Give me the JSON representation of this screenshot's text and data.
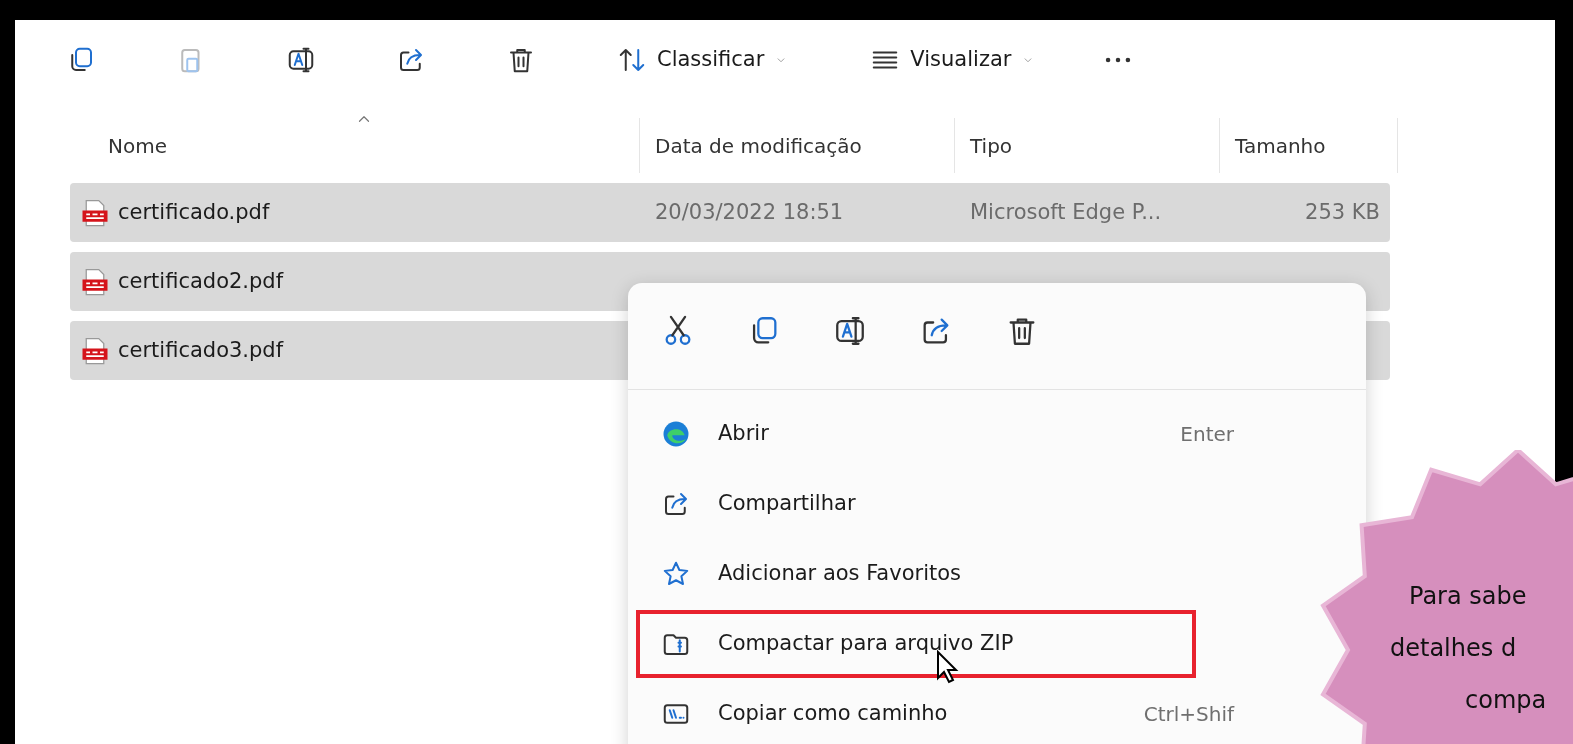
{
  "toolbar": {
    "sort_label": "Classificar",
    "view_label": "Visualizar"
  },
  "columns": [
    {
      "label": "Nome",
      "sorted": true
    },
    {
      "label": "Data de modificação",
      "sorted": false
    },
    {
      "label": "Tipo",
      "sorted": false
    },
    {
      "label": "Tamanho",
      "sorted": false
    }
  ],
  "rows": [
    {
      "name": "certificado.pdf",
      "modified": "20/03/2022 18:51",
      "type": "Microsoft Edge P...",
      "size": "253 KB",
      "selected": true
    },
    {
      "name": "certificado2.pdf",
      "selected": true
    },
    {
      "name": "certificado3.pdf",
      "selected": true
    }
  ],
  "context_menu": {
    "items": [
      {
        "kind": "edge",
        "label": "Abrir",
        "shortcut": "Enter",
        "highlighted": false
      },
      {
        "kind": "share",
        "label": "Compartilhar",
        "highlighted": false
      },
      {
        "kind": "star",
        "label": "Adicionar aos Favoritos",
        "highlighted": false
      },
      {
        "kind": "zip",
        "label": "Compactar para arquivo ZIP",
        "highlighted": true
      },
      {
        "kind": "path",
        "label": "Copiar como caminho",
        "shortcut": "Ctrl+Shif",
        "highlighted": false
      }
    ]
  },
  "callout": {
    "lines": [
      "Para sabe",
      "detalhes d",
      "compa"
    ]
  }
}
